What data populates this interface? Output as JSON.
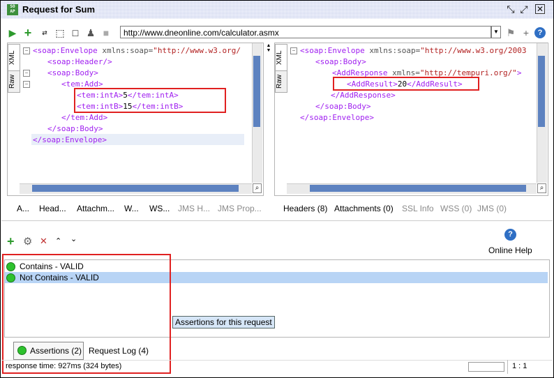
{
  "window": {
    "title": "Request for Sum",
    "logo_text": "SO AP"
  },
  "toolbar": {
    "url": "http://www.dneonline.com/calculator.asmx"
  },
  "request": {
    "tabs": [
      "XML",
      "Raw"
    ],
    "lines": [
      {
        "a": "<soap:Envelope ",
        "b": "xmlns:soap=",
        "c": "\"http://www.w3.org/"
      },
      {
        "a": "<soap:Header/>"
      },
      {
        "a": "<soap:Body>"
      },
      {
        "a": "<tem:Add>"
      },
      {
        "a": "<tem:intA>",
        "v": "5",
        "e": "</tem:intA>"
      },
      {
        "a": "<tem:intB>",
        "v": "15",
        "e": "</tem:intB>"
      },
      {
        "a": "</tem:Add>"
      },
      {
        "a": "</soap:Body>"
      },
      {
        "a": "</soap:Envelope>"
      }
    ],
    "bottom_tabs": [
      "A...",
      "Head...",
      "Attachm...",
      "W...",
      "WS...",
      "JMS H...",
      "JMS Prop..."
    ]
  },
  "response": {
    "tabs": [
      "XML",
      "Raw"
    ],
    "lines": [
      {
        "a": "<soap:Envelope ",
        "b": "xmlns:soap=",
        "c": "\"http://www.w3.org/2003"
      },
      {
        "a": "<soap:Body>"
      },
      {
        "a": "<AddResponse ",
        "b": "xmlns=",
        "c": "\"http://tempuri.org/\"",
        "d": ">"
      },
      {
        "a": "<AddResult>",
        "v": "20",
        "e": "</AddResult>"
      },
      {
        "a": "</AddResponse>"
      },
      {
        "a": "</soap:Body>"
      },
      {
        "a": "</soap:Envelope>"
      }
    ],
    "bottom_tabs": [
      "Headers (8)",
      "Attachments (0)",
      "SSL Info",
      "WSS (0)",
      "JMS (0)"
    ]
  },
  "assertions": {
    "online_help": "Online Help",
    "items": [
      "Contains - VALID",
      "Not Contains - VALID"
    ],
    "tooltip": "Assertions for this request",
    "tab_assertions": "Assertions (2)",
    "tab_request_log": "Request Log (4)",
    "status_color": "#2ec22e"
  },
  "status": {
    "response_time": "response time: 927ms (324 bytes)",
    "position": "1 : 1"
  }
}
